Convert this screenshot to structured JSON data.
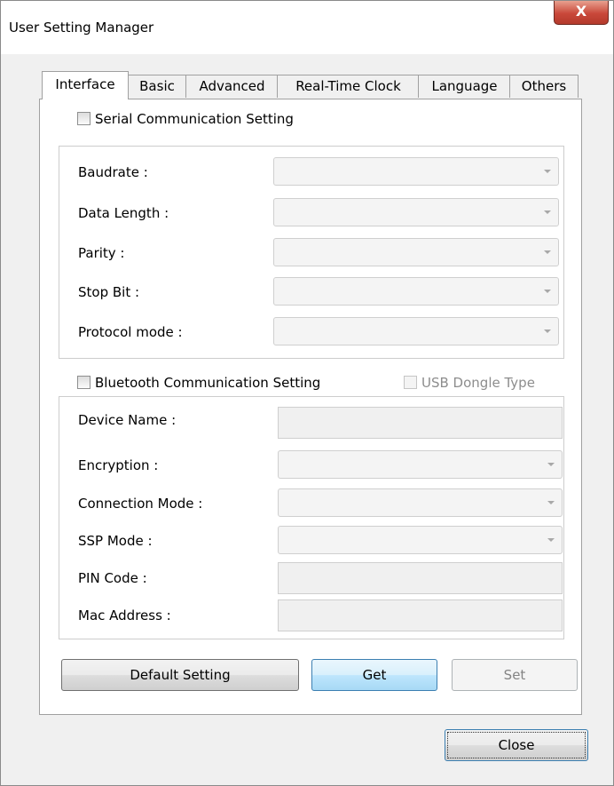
{
  "window": {
    "title": "User Setting Manager",
    "close_glyph": "X"
  },
  "tabs": [
    {
      "label": "Interface",
      "active": true
    },
    {
      "label": "Basic"
    },
    {
      "label": "Advanced"
    },
    {
      "label": "Real-Time Clock"
    },
    {
      "label": "Language"
    },
    {
      "label": "Others"
    }
  ],
  "serial": {
    "checkbox_label": "Serial Communication Setting",
    "checked": false,
    "fields": [
      {
        "label": "Baudrate :",
        "value": ""
      },
      {
        "label": "Data Length :",
        "value": ""
      },
      {
        "label": "Parity :",
        "value": ""
      },
      {
        "label": "Stop Bit :",
        "value": ""
      },
      {
        "label": "Protocol mode :",
        "value": ""
      }
    ]
  },
  "bluetooth": {
    "checkbox_label": "Bluetooth Communication Setting",
    "checked": false,
    "usb_dongle_label": "USB Dongle Type",
    "usb_dongle_enabled": false,
    "fields": [
      {
        "label": "Device Name :",
        "value": ""
      },
      {
        "label": "Encryption :",
        "value": ""
      },
      {
        "label": "Connection Mode :",
        "value": ""
      },
      {
        "label": "SSP Mode :",
        "value": ""
      },
      {
        "label": "PIN Code :",
        "value": ""
      },
      {
        "label": "Mac Address :",
        "value": ""
      }
    ]
  },
  "buttons": {
    "default_setting": "Default Setting",
    "get": "Get",
    "set": "Set",
    "close": "Close"
  },
  "icons": {
    "checkbox": "checkbox-icon",
    "dropdown": "chevron-down-icon"
  }
}
